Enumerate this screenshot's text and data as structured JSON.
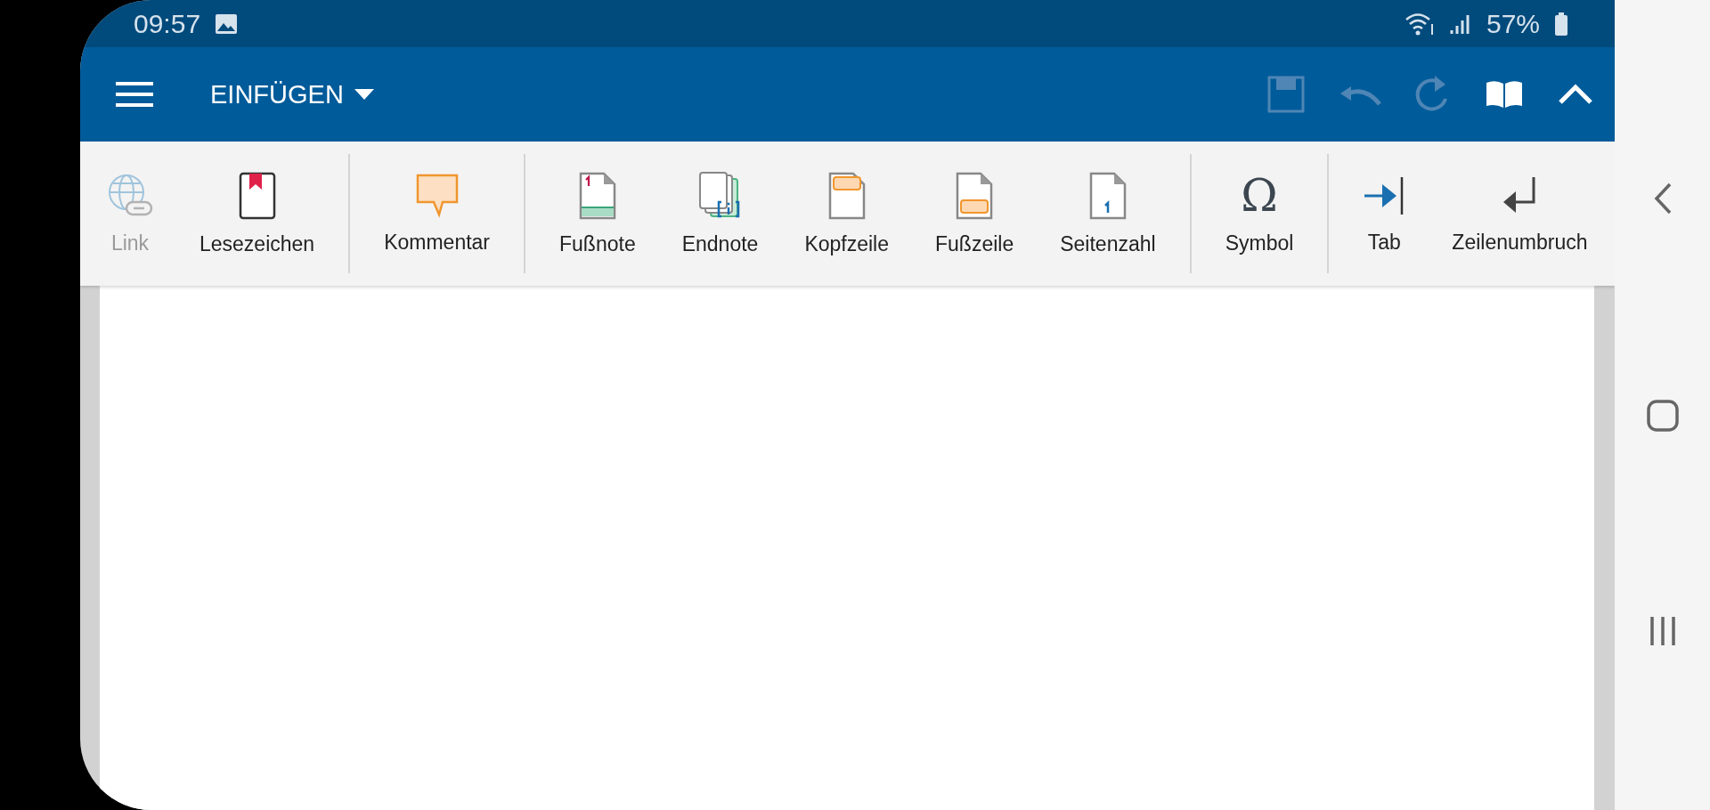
{
  "status_bar": {
    "time": "09:57",
    "battery": "57%"
  },
  "app_bar": {
    "menu_title": "EINFÜGEN",
    "actions": [
      {
        "kind": "save",
        "disabled": true
      },
      {
        "kind": "undo",
        "disabled": true
      },
      {
        "kind": "redo",
        "disabled": true
      },
      {
        "kind": "book",
        "disabled": false
      },
      {
        "kind": "collapse",
        "disabled": false
      }
    ]
  },
  "toolbar": {
    "groups": [
      [
        {
          "kind": "link",
          "label": "Link",
          "disabled": true
        },
        {
          "kind": "bookmark",
          "label": "Lesezeichen",
          "disabled": false
        }
      ],
      [
        {
          "kind": "comment",
          "label": "Kommentar",
          "disabled": false
        }
      ],
      [
        {
          "kind": "footnote",
          "label": "Fußnote",
          "disabled": false
        },
        {
          "kind": "endnote",
          "label": "Endnote",
          "disabled": false
        },
        {
          "kind": "header",
          "label": "Kopfzeile",
          "disabled": false
        },
        {
          "kind": "footer",
          "label": "Fußzeile",
          "disabled": false
        },
        {
          "kind": "pagenumber",
          "label": "Seitenzahl",
          "disabled": false
        }
      ],
      [
        {
          "kind": "symbol",
          "label": "Symbol",
          "glyph": "Ω",
          "disabled": false
        }
      ],
      [
        {
          "kind": "tab",
          "label": "Tab",
          "disabled": false
        },
        {
          "kind": "linebreak",
          "label": "Zeilenumbruch",
          "disabled": false
        }
      ]
    ]
  },
  "nav_bar": [
    {
      "kind": "back"
    },
    {
      "kind": "home"
    },
    {
      "kind": "recents"
    }
  ]
}
